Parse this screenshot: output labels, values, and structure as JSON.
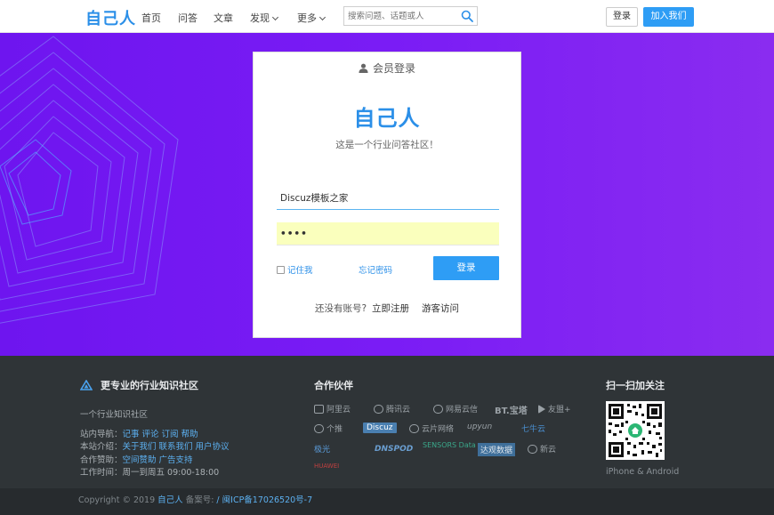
{
  "header": {
    "logo": "自己人",
    "nav": [
      {
        "label": "首页"
      },
      {
        "label": "问答"
      },
      {
        "label": "文章"
      },
      {
        "label": "发现"
      },
      {
        "label": "更多"
      }
    ],
    "search_placeholder": "搜索问题、话题或人",
    "login_label": "登录",
    "join_label": "加入我们"
  },
  "login": {
    "heading": "会员登录",
    "brand": "自己人",
    "slogan": "这是一个行业问答社区！",
    "username_value": "Discuz模板之家",
    "password_value": "••••",
    "remember_label": "记住我",
    "forgot_label": "忘记密码",
    "submit_label": "登录",
    "no_account_text": "还没有账号?",
    "register_label": "立即注册",
    "guest_label": "游客访问"
  },
  "footer": {
    "about_title": "更专业的行业知识社区",
    "about_sub": "一个行业知识社区",
    "site_nav_label": "站内导航：",
    "site_nav_links": "记事 评论 订阅 帮助",
    "intro_label": "本站介绍：",
    "intro_links": "关于我们 联系我们 用户协议",
    "partner_label": "合作赞助：",
    "partner_links": "空间赞助 广告支持",
    "hours_label": "工作时间：",
    "hours_value": "周一到周五 09:00-18:00",
    "partners_title": "合作伙伴",
    "partners": [
      "阿里云",
      "腾讯云",
      "网易云信",
      "BT.宝塔",
      "友盟+",
      "个推",
      "Discuz",
      "云片网络",
      "upyun",
      "七牛云",
      "极光",
      "DNSPOD",
      "SENSORS Data",
      "达观数据",
      "新云",
      "HUAWEI"
    ],
    "qr_title": "扫一扫加关注",
    "qr_caption": "iPhone & Android"
  },
  "copyright": {
    "text": "Copyright © 2019 ",
    "site": "自己人",
    "icp_label": " 备案号: ",
    "icp": "/ 闽ICP备17026520号-7"
  }
}
